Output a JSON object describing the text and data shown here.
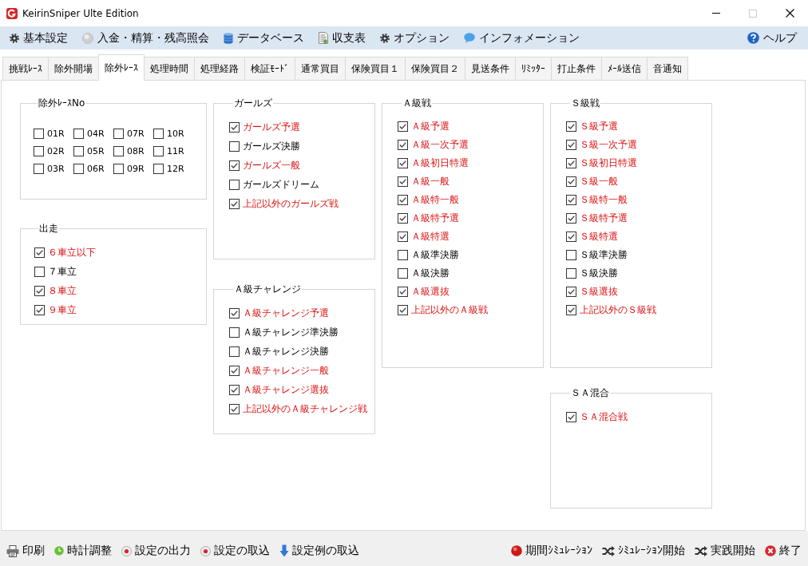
{
  "window": {
    "title": "KeirinSniper Ulte Edition",
    "maximize_disabled": true
  },
  "menu_bar": {
    "items": [
      {
        "label": "基本設定"
      },
      {
        "label": "入金・精算・残高照会"
      },
      {
        "label": "データベース"
      },
      {
        "label": "収支表"
      },
      {
        "label": "オプション"
      },
      {
        "label": "インフォメーション"
      }
    ],
    "help": {
      "label": "ヘルプ"
    }
  },
  "tabs": [
    {
      "label": "挑戦ﾚｰｽ",
      "selected": false
    },
    {
      "label": "除外開場",
      "selected": false
    },
    {
      "label": "除外ﾚｰｽ",
      "selected": true
    },
    {
      "label": "処理時間",
      "selected": false
    },
    {
      "label": "処理経路",
      "selected": false
    },
    {
      "label": "検証ﾓｰﾄﾞ",
      "selected": false
    },
    {
      "label": "通常買目",
      "selected": false
    },
    {
      "label": "保険買目１",
      "selected": false
    },
    {
      "label": "保険買目２",
      "selected": false
    },
    {
      "label": "見送条件",
      "selected": false
    },
    {
      "label": "ﾘﾐｯﾀｰ",
      "selected": false
    },
    {
      "label": "打止条件",
      "selected": false
    },
    {
      "label": "ﾒｰﾙ送信",
      "selected": false
    },
    {
      "label": "音通知",
      "selected": false
    }
  ],
  "columns": [
    {
      "groups": [
        {
          "title": "除外ﾚｰｽNo",
          "kind": "grid",
          "items": [
            {
              "label": "01R",
              "checked": false
            },
            {
              "label": "02R",
              "checked": false
            },
            {
              "label": "03R",
              "checked": false
            },
            {
              "label": "04R",
              "checked": false
            },
            {
              "label": "05R",
              "checked": false
            },
            {
              "label": "06R",
              "checked": false
            },
            {
              "label": "07R",
              "checked": false
            },
            {
              "label": "08R",
              "checked": false
            },
            {
              "label": "09R",
              "checked": false
            },
            {
              "label": "10R",
              "checked": false
            },
            {
              "label": "11R",
              "checked": false
            },
            {
              "label": "12R",
              "checked": false
            }
          ]
        },
        {
          "title": "出走",
          "kind": "list",
          "items": [
            {
              "label": "６車立以下",
              "checked": true
            },
            {
              "label": "７車立",
              "checked": false
            },
            {
              "label": "８車立",
              "checked": true
            },
            {
              "label": "９車立",
              "checked": true
            }
          ]
        }
      ]
    },
    {
      "groups": [
        {
          "title": "ガールズ",
          "kind": "list",
          "items": [
            {
              "label": "ガールズ予選",
              "checked": true
            },
            {
              "label": "ガールズ決勝",
              "checked": false
            },
            {
              "label": "ガールズ一般",
              "checked": true
            },
            {
              "label": "ガールズドリーム",
              "checked": false
            },
            {
              "label": "上記以外のガールズ戦",
              "checked": true
            }
          ]
        },
        {
          "title": "Ａ級チャレンジ",
          "kind": "list",
          "items": [
            {
              "label": "Ａ級チャレンジ予選",
              "checked": true
            },
            {
              "label": "Ａ級チャレンジ準決勝",
              "checked": false
            },
            {
              "label": "Ａ級チャレンジ決勝",
              "checked": false
            },
            {
              "label": "Ａ級チャレンジ一般",
              "checked": true
            },
            {
              "label": "Ａ級チャレンジ選抜",
              "checked": true
            },
            {
              "label": "上記以外のＡ級チャレンジ戦",
              "checked": true
            }
          ]
        }
      ]
    },
    {
      "groups": [
        {
          "title": "Ａ級戦",
          "kind": "list",
          "items": [
            {
              "label": "Ａ級予選",
              "checked": true
            },
            {
              "label": "Ａ級一次予選",
              "checked": true
            },
            {
              "label": "Ａ級初日特選",
              "checked": true
            },
            {
              "label": "Ａ級一般",
              "checked": true
            },
            {
              "label": "Ａ級特一般",
              "checked": true
            },
            {
              "label": "Ａ級特予選",
              "checked": true
            },
            {
              "label": "Ａ級特選",
              "checked": true
            },
            {
              "label": "Ａ級準決勝",
              "checked": false
            },
            {
              "label": "Ａ級決勝",
              "checked": false
            },
            {
              "label": "Ａ級選抜",
              "checked": true
            },
            {
              "label": "上記以外のＡ級戦",
              "checked": true
            }
          ]
        }
      ]
    },
    {
      "groups": [
        {
          "title": "Ｓ級戦",
          "kind": "list",
          "items": [
            {
              "label": "Ｓ級予選",
              "checked": true
            },
            {
              "label": "Ｓ級一次予選",
              "checked": true
            },
            {
              "label": "Ｓ級初日特選",
              "checked": true
            },
            {
              "label": "Ｓ級一般",
              "checked": true
            },
            {
              "label": "Ｓ級特一般",
              "checked": true
            },
            {
              "label": "Ｓ級特予選",
              "checked": true
            },
            {
              "label": "Ｓ級特選",
              "checked": true
            },
            {
              "label": "Ｓ級準決勝",
              "checked": false
            },
            {
              "label": "Ｓ級決勝",
              "checked": false
            },
            {
              "label": "Ｓ級選抜",
              "checked": true
            },
            {
              "label": "上記以外のＳ級戦",
              "checked": true
            }
          ]
        },
        {
          "title": "ＳＡ混合",
          "kind": "list",
          "items": [
            {
              "label": "ＳＡ混合戦",
              "checked": true
            }
          ]
        }
      ]
    }
  ],
  "bottom_bar": {
    "left": [
      {
        "label": "印刷"
      },
      {
        "label": "時計調整"
      },
      {
        "label": "設定の出力"
      },
      {
        "label": "設定の取込"
      },
      {
        "label": "設定例の取込"
      }
    ],
    "right": [
      {
        "label": "期間ｼﾐｭﾚｰｼｮﾝ"
      },
      {
        "label": "ｼﾐｭﾚｰｼｮﾝ開始"
      },
      {
        "label": "実践開始"
      },
      {
        "label": "終了"
      }
    ]
  }
}
